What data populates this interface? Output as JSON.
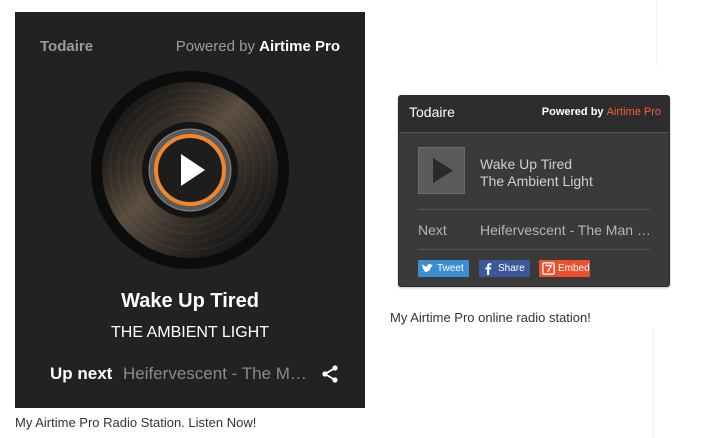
{
  "big_player": {
    "station": "Todaire",
    "powered_prefix": "Powered by ",
    "powered_brand": "Airtime Pro",
    "now_playing_title": "Wake Up Tired",
    "now_playing_artist": "THE AMBIENT LIGHT",
    "up_next_label": "Up next",
    "up_next_track": "Heifervescent - The Man from the Sun",
    "caption": "My Airtime Pro Radio Station. Listen Now!",
    "accent_color": "#f0852d"
  },
  "small_widget": {
    "station": "Todaire",
    "powered_prefix": "Powered by ",
    "powered_brand": "Airtime Pro",
    "title": "Wake Up Tired",
    "artist": "The Ambient Light",
    "next_label": "Next",
    "next_track": "Heifervescent - The Man from the Sun",
    "buttons": {
      "tweet": "Tweet",
      "share": "Share",
      "embed": "Embed"
    },
    "caption": "My Airtime Pro online radio station!",
    "brand_color": "#ff5a36"
  }
}
